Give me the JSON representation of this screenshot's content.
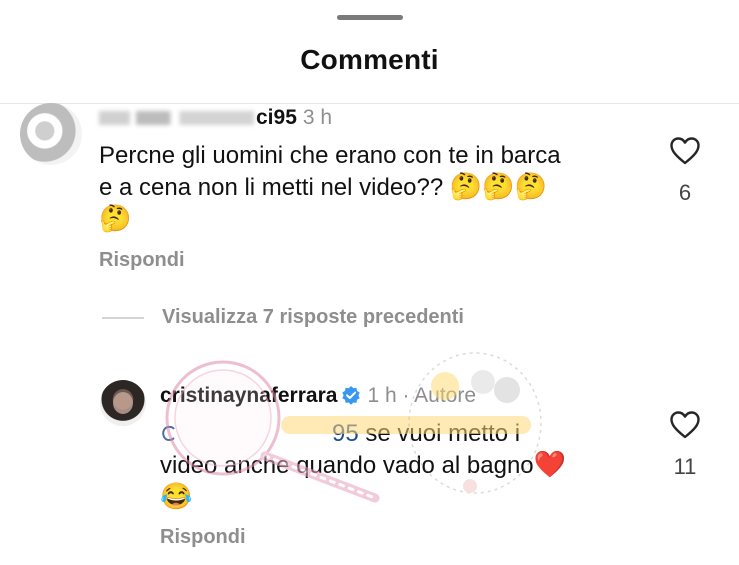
{
  "header": {
    "title": "Commenti"
  },
  "comments": [
    {
      "username_visible": "ci95",
      "time": "3 h",
      "text_line1": "Percne gli uomini che erano con te in barca",
      "text_line2": "e a cena non li metti nel video??",
      "emoji_thinking": "🤔",
      "like_count": "6",
      "reply_label": "Rispondi"
    }
  ],
  "view_replies_label": "Visualizza 7 risposte precedenti",
  "reply": {
    "username": "cristinaynaferrara",
    "time": "1 h",
    "author_badge": "Autore",
    "mention": "95",
    "text_line1": "se vuoi metto i",
    "text_line2": "video anche quando vado al bagno",
    "heart_emoji": "❤️",
    "laugh_emoji": "😂",
    "like_count": "11",
    "reply_label": "Rispondi"
  },
  "colors": {
    "secondary_text": "#8e8e8e",
    "mention": "#1f4c8f",
    "verified": "#3897f0"
  },
  "icons": {
    "like": "heart-outline-icon",
    "verified": "verified-badge-icon",
    "grabber": "drag-handle"
  }
}
